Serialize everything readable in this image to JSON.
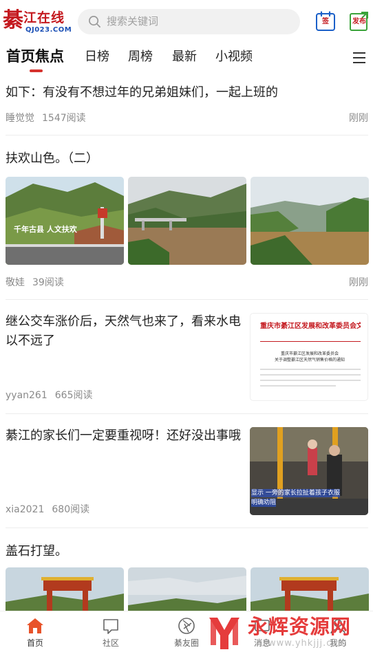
{
  "header": {
    "logo_char": "綦",
    "logo_name": "江在线",
    "logo_domain": "QJ023.COM",
    "search_placeholder": "搜索关键词",
    "sign_label": "签",
    "publish_label": "发布"
  },
  "tabs": [
    {
      "label": "首页焦点",
      "active": true
    },
    {
      "label": "日榜",
      "active": false
    },
    {
      "label": "周榜",
      "active": false
    },
    {
      "label": "最新",
      "active": false
    },
    {
      "label": "小视频",
      "active": false
    }
  ],
  "feed": [
    {
      "title": "如下：有没有不想过年的兄弟姐妹们，一起上班的",
      "author": "睡觉觉",
      "views": "1547阅读",
      "time": "刚刚"
    },
    {
      "title": "扶欢山色。（二）",
      "author": "敬娃",
      "views": "39阅读",
      "time": "刚刚",
      "image_caption": "千年古县  人文扶欢"
    },
    {
      "title": "继公交车涨价后，天然气也来了，看来水电以不远了",
      "author": "yyan261",
      "views": "665阅读",
      "doc_heading": "重庆市綦江区发展和改革委员会文件",
      "doc_subheading": "重庆市綦江区发展和改革委员会\n关于调整綦江区天然气销售价格的通知"
    },
    {
      "title": "綦江的家长们一定要重视呀！还好没出事哦",
      "author": "xia2021",
      "views": "680阅读",
      "video_caption": "显示 一旁的家长拉扯着孩子衣服",
      "video_caption2": "明确劝阻"
    },
    {
      "title": "盖石打望。"
    }
  ],
  "bottom_nav": [
    {
      "label": "首页",
      "icon": "home-icon",
      "active": true
    },
    {
      "label": "社区",
      "icon": "chat-icon",
      "active": false
    },
    {
      "label": "綦友圈",
      "icon": "aperture-icon",
      "active": false
    },
    {
      "label": "消息",
      "icon": "message-icon",
      "active": false
    },
    {
      "label": "我的",
      "icon": "user-icon",
      "active": false
    }
  ],
  "watermark": {
    "text": "永辉资源网",
    "url": "www.yhkjjj.com"
  },
  "colors": {
    "brand_red": "#c4191f",
    "tab_underline": "#d6322e",
    "meta_gray": "#8a8a8a"
  }
}
